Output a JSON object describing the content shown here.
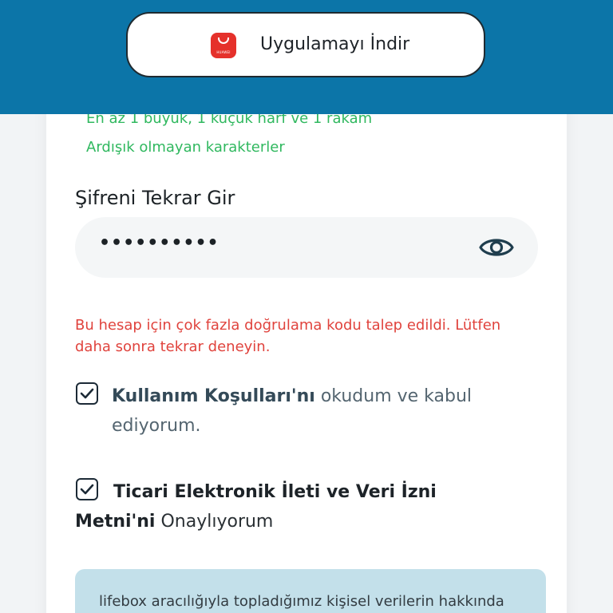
{
  "banner": {
    "download_label": "Uygulamayı İndir",
    "store_icon_name": "huawei-appgallery-icon",
    "store_brand_text": "HUAWEI",
    "background_color": "#0c75a8"
  },
  "password_rules": [
    "En az 1 büyük, 1 küçük harf ve 1 rakam",
    "Ardışık olmayan karakterler"
  ],
  "repeat_password": {
    "label": "Şifreni Tekrar Gir",
    "value": "••••••••••",
    "toggle_icon": "eye-icon"
  },
  "error": {
    "message": "Bu hesap için çok fazla doğrulama kodu talep edildi. Lütfen daha sonra tekrar deneyin."
  },
  "consents": [
    {
      "checked": true,
      "link_text": "Kullanım Koşulları'nı",
      "rest_text": " okudum ve kabul ediyorum."
    },
    {
      "checked": true,
      "link_text": "Ticari Elektronik İleti ve Veri İzni Metni'ni",
      "rest_text": " Onaylıyorum"
    }
  ],
  "info": {
    "text": "lifebox aracılığıyla topladığımız kişisel verilerin hakkında"
  },
  "colors": {
    "success": "#30b85f",
    "error": "#e0433d",
    "info_background": "#c3e0ea"
  }
}
